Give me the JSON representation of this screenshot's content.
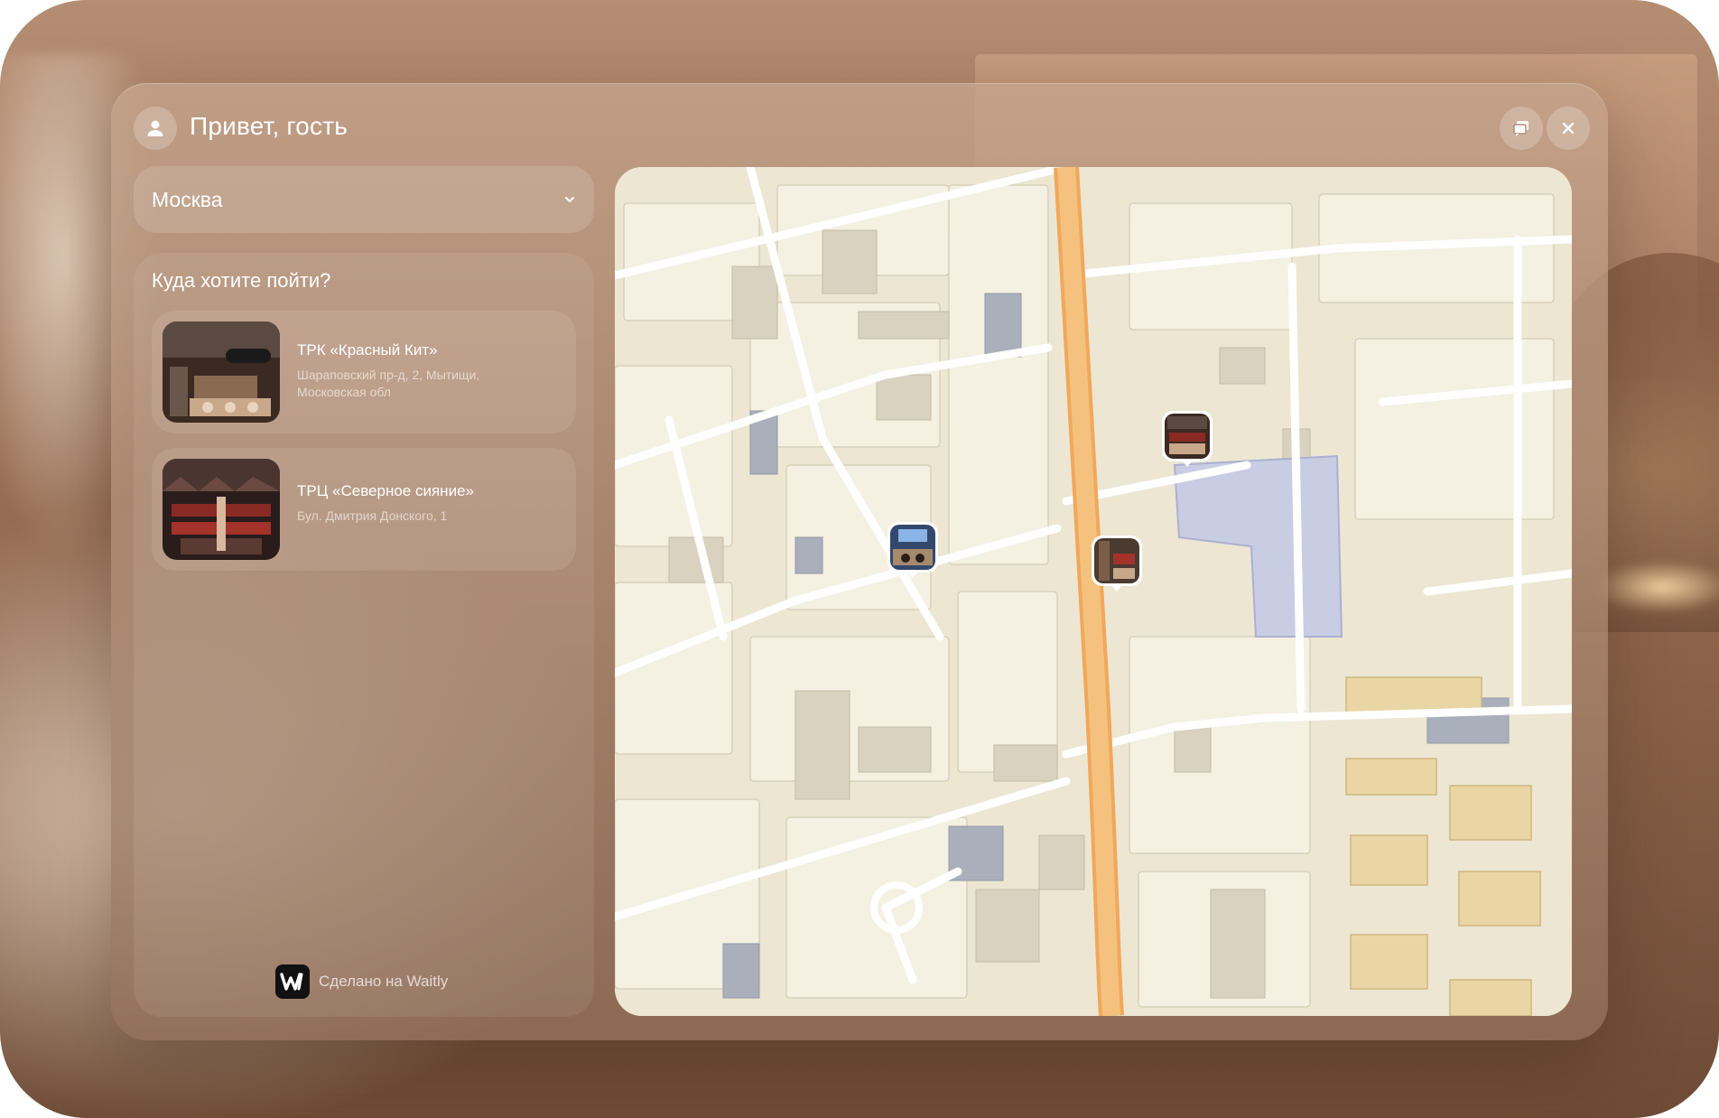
{
  "header": {
    "greeting": "Привет, гость",
    "buttons": [
      {
        "icon": "chat-icon"
      },
      {
        "icon": "close-icon"
      }
    ]
  },
  "city_select": {
    "value": "Москва",
    "icon": "chevron-down-icon"
  },
  "venues": {
    "title": "Куда хотите пойти?",
    "items": [
      {
        "name": "ТРК «Красный Кит»",
        "address": "Шараповский пр-д, 2, Мытищи, Московская обл"
      },
      {
        "name": "ТРЦ «Северное сияние»",
        "address": "Бул. Дмитрия Донского, 1"
      }
    ]
  },
  "footer": {
    "text": "Сделано на Waitly",
    "logo_icon": "waitly-logo-icon"
  },
  "map": {
    "pins": [
      {
        "venue_index": 1
      },
      {
        "venue_index": 0
      },
      {
        "venue_index": 1
      }
    ]
  },
  "colors": {
    "map_background": "#ece6d3",
    "main_road": "#f4c27e",
    "highlight_area": "#c9cde3",
    "buildings_yellow": "#ead6a4",
    "text_primary": "#ffffff"
  }
}
